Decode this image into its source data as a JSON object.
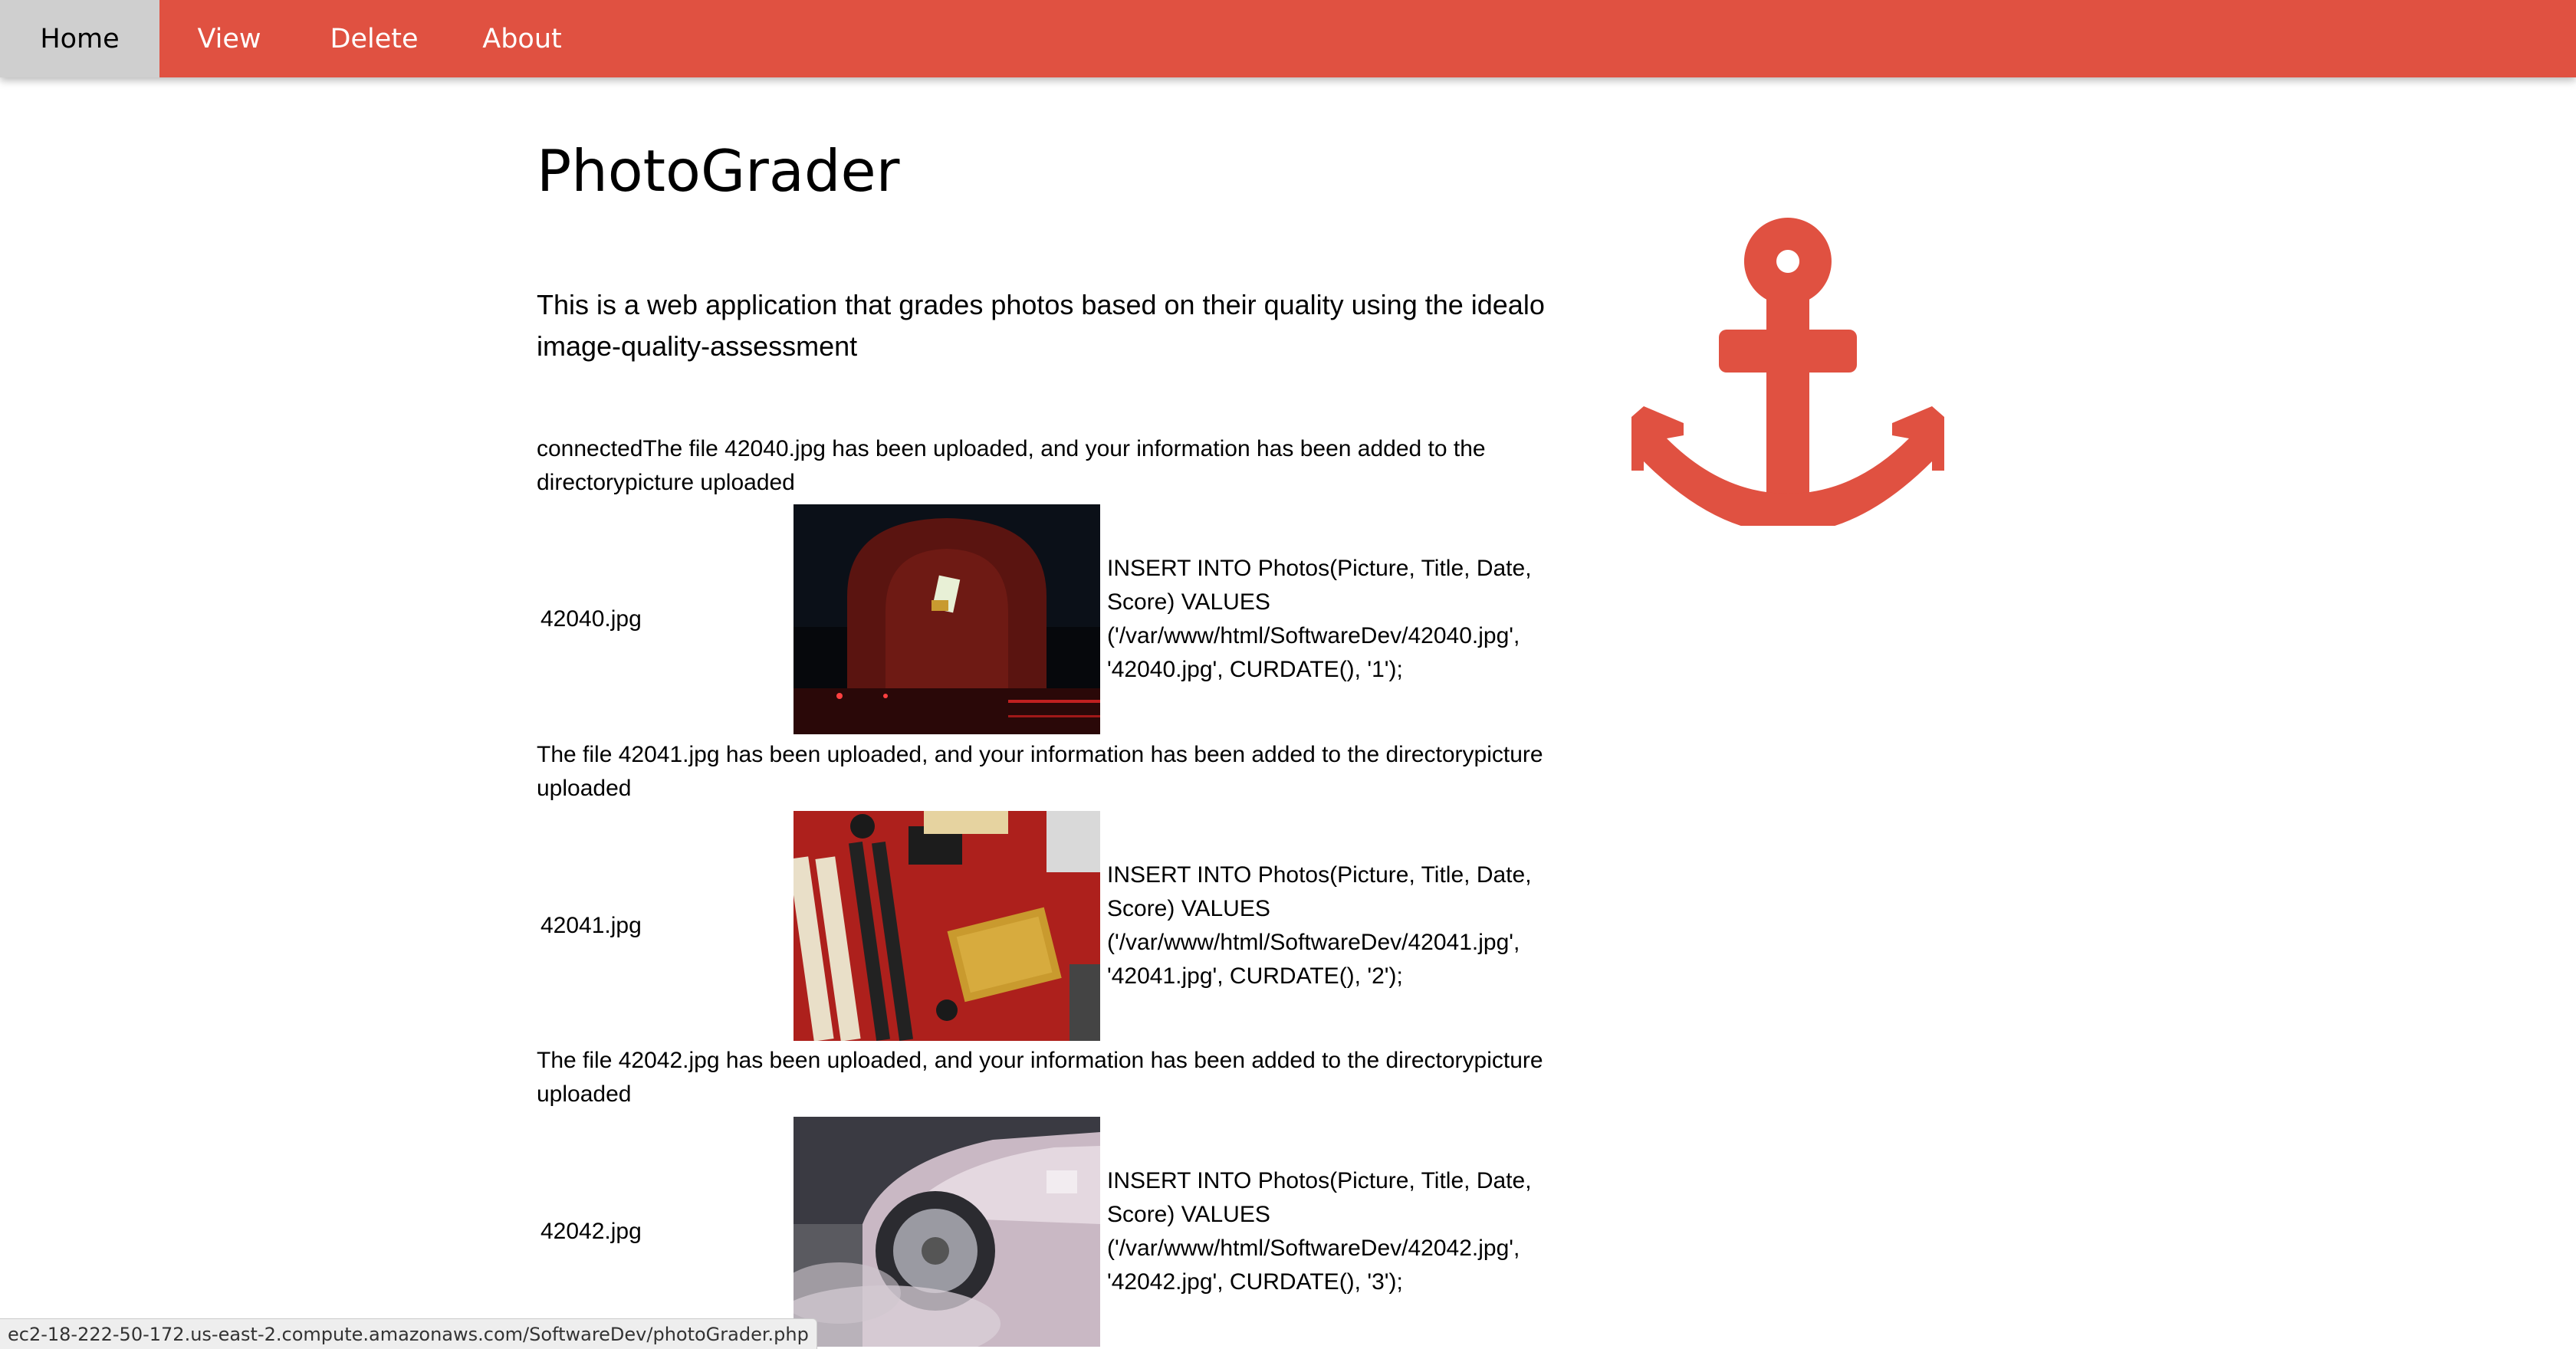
{
  "nav": {
    "items": [
      {
        "label": "Home",
        "active": true
      },
      {
        "label": "View",
        "active": false
      },
      {
        "label": "Delete",
        "active": false
      },
      {
        "label": "About",
        "active": false
      }
    ]
  },
  "page": {
    "title": "PhotoGrader",
    "intro": "This is a web application that grades photos based on their quality using the idealo image-quality-assessment"
  },
  "log": {
    "first_message": "connectedThe file 42040.jpg has been uploaded, and your information has been added to the directorypicture uploaded",
    "rows": [
      {
        "filename": "42040.jpg",
        "sql_1": "INSERT INTO Photos(Picture, Title, Date,",
        "sql_2": "Score) VALUES",
        "sql_3": "('/var/www/html/SoftwareDev/42040.jpg',",
        "sql_4": "'42040.jpg', CURDATE(), '1');"
      },
      {
        "filename": "42041.jpg",
        "sql_1": "INSERT INTO Photos(Picture, Title, Date,",
        "sql_2": "Score) VALUES",
        "sql_3": "('/var/www/html/SoftwareDev/42041.jpg',",
        "sql_4": "'42041.jpg', CURDATE(), '2');"
      },
      {
        "filename": "42042.jpg",
        "sql_1": "INSERT INTO Photos(Picture, Title, Date,",
        "sql_2": "Score) VALUES",
        "sql_3": "('/var/www/html/SoftwareDev/42042.jpg',",
        "sql_4": "'42042.jpg', CURDATE(), '3');"
      }
    ],
    "upload_messages": [
      "The file 42041.jpg has been uploaded, and your information has been added to the directorypicture uploaded",
      "The file 42042.jpg has been uploaded, and your information has been added to the directorypicture uploaded"
    ]
  },
  "status_bar": {
    "url": "ec2-18-222-50-172.us-east-2.compute.amazonaws.com/SoftwareDev/photoGrader.php"
  },
  "colors": {
    "accent": "#e05141",
    "active_tab": "#cfcfcf"
  },
  "icons": {
    "hero": "anchor-icon"
  }
}
